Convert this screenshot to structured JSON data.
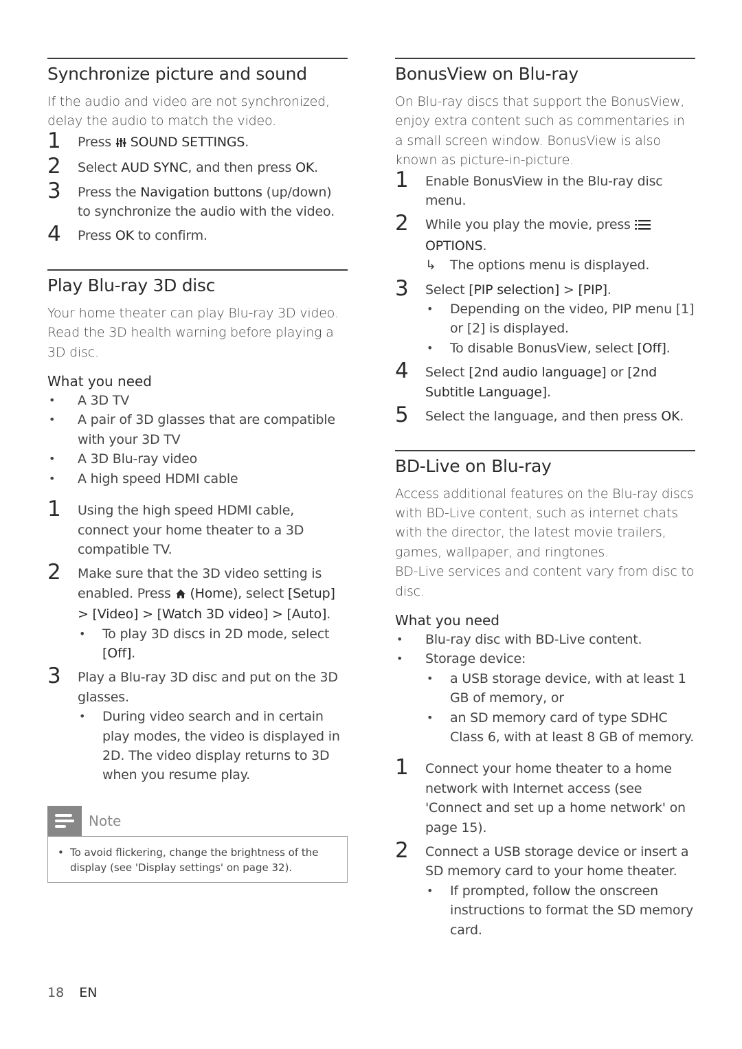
{
  "left": {
    "sync": {
      "title": "Synchronize picture and sound",
      "intro": "If the audio and video are not synchronized, delay the audio to match the video.",
      "steps": [
        {
          "num": "1",
          "pre": "Press ",
          "icon": "sound-settings-icon",
          "em": "SOUND SETTINGS",
          "post": "."
        },
        {
          "num": "2",
          "pre": "Select ",
          "em": "AUD SYNC",
          "mid": ", and then press ",
          "em2": "OK",
          "post": "."
        },
        {
          "num": "3",
          "pre": "Press the ",
          "em": "Navigation buttons",
          "post": " (up/down) to synchronize the audio with the video."
        },
        {
          "num": "4",
          "pre": "Press ",
          "em": "OK",
          "post": " to confirm."
        }
      ]
    },
    "play3d": {
      "title": "Play Blu-ray 3D disc",
      "intro": "Your home theater can play Blu-ray 3D video. Read the 3D health warning before playing a 3D disc.",
      "need_title": "What you need",
      "needs": [
        "A 3D TV",
        "A pair of 3D glasses that are compatible with your 3D TV",
        "A 3D Blu-ray video",
        "A high speed HDMI cable"
      ],
      "steps": [
        {
          "num": "1",
          "text": "Using the high speed HDMI cable, connect your home theater to a 3D compatible TV."
        },
        {
          "num": "2",
          "pre": "Make sure that the 3D video setting is enabled. Press ",
          "icon": "home-icon",
          "em": "(Home)",
          "mid": ", select ",
          "path": "[Setup] > [Video] > [Watch 3D video] > [Auto]",
          "post": ".",
          "bullets": [
            {
              "pre": "To play 3D discs in 2D mode, select ",
              "em": "[Off]",
              "post": "."
            }
          ]
        },
        {
          "num": "3",
          "text": "Play a Blu-ray 3D disc and put on the 3D glasses.",
          "bullets": [
            {
              "pre": "During video search and in certain play modes, the video is displayed in 2D. The video display returns to 3D when you resume play."
            }
          ]
        }
      ]
    },
    "note": {
      "label": "Note",
      "items": [
        "To avoid flickering, change the brightness of the display (see 'Display settings' on page 32)."
      ]
    }
  },
  "right": {
    "bonusview": {
      "title": "BonusView on Blu-ray",
      "intro": "On Blu-ray discs that support the BonusView, enjoy extra content such as commentaries in a small screen window. BonusView is also known as picture-in-picture.",
      "steps": [
        {
          "num": "1",
          "text": "Enable BonusView in the Blu-ray disc menu."
        },
        {
          "num": "2",
          "pre": "While you play the movie, press ",
          "icon": "options-icon",
          "em": "OPTIONS",
          "post": ".",
          "result": "The options menu is displayed."
        },
        {
          "num": "3",
          "pre": "Select ",
          "em": "[PIP selection]",
          "mid": " > ",
          "em2": "[PIP]",
          "post": ".",
          "bullets": [
            {
              "pre": "Depending on the video, PIP menu [1] or [2] is displayed."
            },
            {
              "pre": "To disable BonusView, select ",
              "em": "[Off]",
              "post": "."
            }
          ]
        },
        {
          "num": "4",
          "pre": "Select ",
          "em": "[2nd audio language]",
          "mid": " or ",
          "em2": "[2nd Subtitle Language]",
          "post": "."
        },
        {
          "num": "5",
          "pre": "Select the language, and then press ",
          "em": "OK",
          "post": "."
        }
      ]
    },
    "bdlive": {
      "title": "BD-Live on Blu-ray",
      "intro": "Access additional features on the Blu-ray discs with BD-Live content, such as internet chats with the director, the latest movie trailers, games, wallpaper, and ringtones.",
      "intro2": "BD-Live services and content vary from disc to disc.",
      "need_title": "What you need",
      "needs": [
        "Blu-ray disc with BD-Live content.",
        "Storage device:"
      ],
      "sub_needs": [
        "a USB storage device, with at least 1 GB of memory, or",
        "an SD memory card of type SDHC Class 6, with at least 8 GB of memory."
      ],
      "steps": [
        {
          "num": "1",
          "text": "Connect your home theater to a home network with Internet access (see 'Connect and set up a home network' on page 15)."
        },
        {
          "num": "2",
          "text": "Connect a USB storage device or insert a SD memory card to your home theater.",
          "bullets": [
            {
              "pre": "If prompted, follow the onscreen instructions to format the SD memory card."
            }
          ]
        }
      ]
    }
  },
  "footer": {
    "page": "18",
    "lang": "EN"
  },
  "colors": {
    "text": "#444444",
    "heading": "#2a2a2a",
    "note_icon_bg": "#878787",
    "rule": "#3a3a3a"
  }
}
